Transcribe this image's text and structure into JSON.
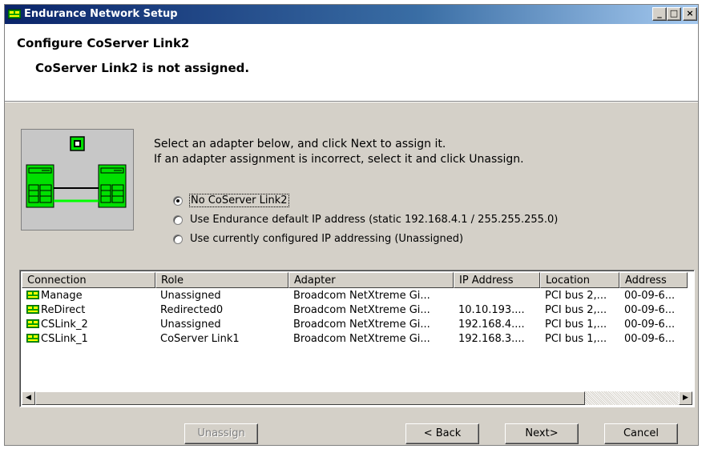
{
  "window": {
    "title": "Endurance Network Setup",
    "controls": {
      "minimize": "_",
      "maximize": "□",
      "close": "×"
    }
  },
  "header": {
    "title": "Configure CoServer Link2",
    "subtitle": "CoServer Link2 is not assigned."
  },
  "instructions": {
    "line1": "Select an adapter below, and click Next to assign it.",
    "line2": "If an adapter assignment is incorrect, select it and click Unassign."
  },
  "options": [
    {
      "label": "No CoServer Link2",
      "selected": true
    },
    {
      "label": "Use Endurance default IP address (static 192.168.4.1 / 255.255.255.0)",
      "selected": false
    },
    {
      "label": "Use currently configured IP addressing (Unassigned)",
      "selected": false
    }
  ],
  "table": {
    "columns": [
      "Connection",
      "Role",
      "Adapter",
      "IP Address",
      "Location",
      "Address"
    ],
    "rows": [
      [
        "Manage",
        "Unassigned",
        "Broadcom NetXtreme Gi...",
        "",
        "PCI bus 2,...",
        "00-09-6..."
      ],
      [
        "ReDirect",
        "Redirected0",
        "Broadcom NetXtreme Gi...",
        "10.10.193....",
        "PCI bus 2,...",
        "00-09-6..."
      ],
      [
        "CSLink_2",
        "Unassigned",
        "Broadcom NetXtreme Gi...",
        "192.168.4....",
        "PCI bus 1,...",
        "00-09-6..."
      ],
      [
        "CSLink_1",
        "CoServer Link1",
        "Broadcom NetXtreme Gi...",
        "192.168.3....",
        "PCI bus 1,...",
        "00-09-6..."
      ]
    ]
  },
  "buttons": {
    "unassign": "Unassign",
    "back": "< Back",
    "next": "Next>",
    "cancel": "Cancel"
  },
  "icons": {
    "window": "network-setup-icon",
    "illustration": "server-link-illustration",
    "row": "network-adapter-icon"
  },
  "colors": {
    "title_bar": "#0a246a",
    "dialog_face": "#d4d0c8",
    "illustration_green": "#00cc00"
  }
}
